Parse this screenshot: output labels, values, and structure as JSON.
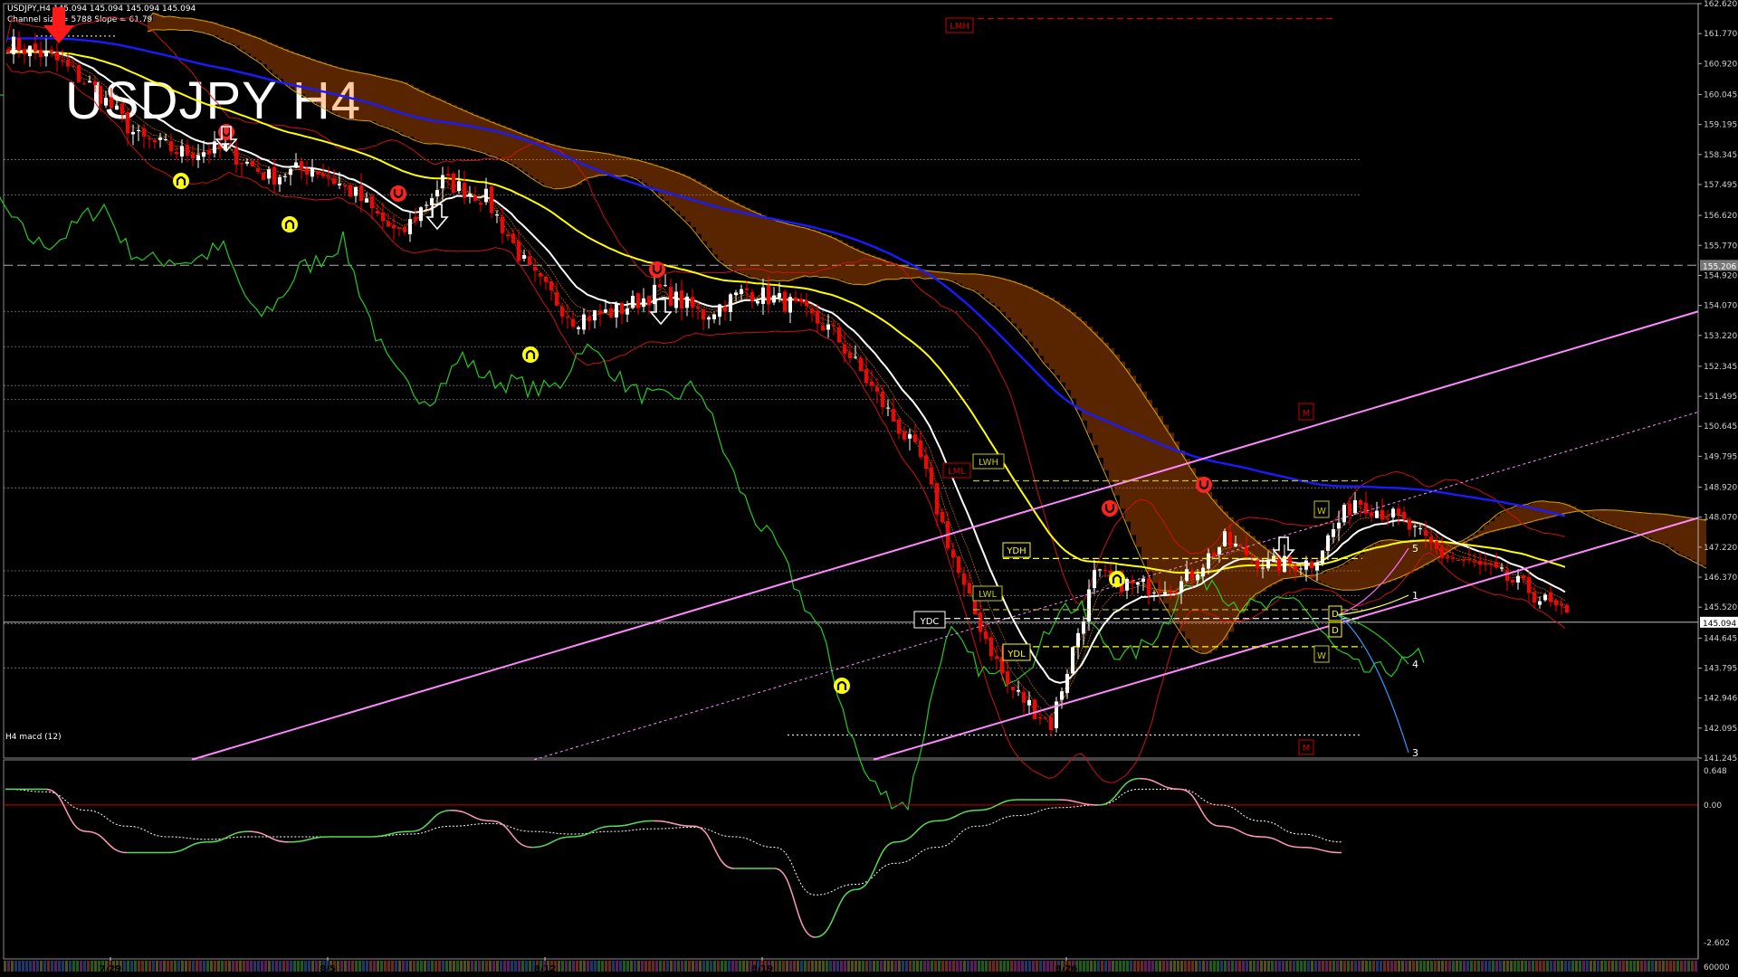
{
  "header": {
    "info_line": "USDJPY,H4  145.094 145.094 145.094 145.094",
    "channel_line": "Channel size = 5788 Slope = 61.79",
    "watermark": "USDJPY H4"
  },
  "sub": {
    "label": "H4  macd (12)"
  },
  "colors": {
    "bg": "#000000",
    "bull": "#ffffff",
    "bear": "#ff0000",
    "ema_white": "#ffffff",
    "ema_yellow": "#ffff00",
    "ema_blue": "#1a1aff",
    "channel": "#ff88ff",
    "chikou": "#22cc22",
    "cloud": "#ff6a00",
    "macd_main": "#55dd55",
    "macd_neg": "#ff99bb",
    "axis": "#d0d0d0"
  },
  "chart_data": [
    {
      "type": "candlestick",
      "symbol": "USDJPY",
      "timeframe": "H4",
      "title": "USDJPY H4",
      "ylim": [
        141.245,
        162.62
      ],
      "yticks": [
        162.62,
        161.77,
        160.92,
        160.045,
        159.195,
        158.345,
        157.495,
        156.62,
        155.77,
        154.92,
        154.07,
        153.22,
        152.345,
        151.495,
        150.645,
        149.795,
        148.92,
        148.07,
        147.22,
        146.37,
        145.52,
        144.645,
        143.795,
        142.946,
        142.095,
        141.245
      ],
      "current_price": 145.094,
      "current_price_label": "145.094",
      "marked_level": 155.206,
      "marked_level_label": "155.206",
      "xticks": [
        "7/29",
        "8/5",
        "8/12",
        "8/19",
        "8/26"
      ],
      "price_path": [
        161.5,
        161.1,
        160.2,
        158.8,
        158.4,
        158.5,
        157.7,
        158.0,
        157.2,
        156.0,
        157.6,
        157.1,
        155.0,
        153.7,
        153.9,
        154.5,
        153.8,
        154.5,
        154.1,
        153.3,
        151.5,
        149.7,
        146.0,
        143.3,
        142.2,
        146.4,
        146.1,
        146.2,
        147.4,
        146.7,
        146.8,
        148.6,
        148.0,
        147.0,
        146.6,
        146.0,
        145.1
      ],
      "price_lines": [
        {
          "label": "LMH",
          "value": 162.2,
          "style": "dashed",
          "color": "#cc0000"
        },
        {
          "label": "LWH",
          "value": 149.1,
          "style": "dashed",
          "color": "#c8c800"
        },
        {
          "label": "YDH",
          "value": 146.9,
          "style": "dashed",
          "color": "#ffff00"
        },
        {
          "label": "LWL",
          "value": 145.45,
          "style": "dashed",
          "color": "#c8c800"
        },
        {
          "label": "YDC",
          "value": 145.2,
          "style": "dashed",
          "color": "#ffffff"
        },
        {
          "label": "YDL",
          "value": 144.4,
          "style": "dashed",
          "color": "#ffff00"
        }
      ],
      "box_labels": [
        {
          "text": "LMH",
          "color": "#cc0000"
        },
        {
          "text": "LWH",
          "color": "#c8c800"
        },
        {
          "text": "LML",
          "color": "#cc0000"
        },
        {
          "text": "YDH",
          "color": "#ffff00"
        },
        {
          "text": "LWL",
          "color": "#c8c800"
        },
        {
          "text": "YDC",
          "color": "#ffffff"
        },
        {
          "text": "YDL",
          "color": "#ffff00"
        },
        {
          "text": "M",
          "color": "#cc0000"
        },
        {
          "text": "M",
          "color": "#cc0000"
        },
        {
          "text": "W",
          "color": "#c8c800"
        },
        {
          "text": "W",
          "color": "#c8c800"
        },
        {
          "text": "D",
          "color": "#ffff00"
        },
        {
          "text": "D",
          "color": "#ffff00"
        }
      ],
      "projection_labels": [
        "5",
        "1",
        "4",
        "3"
      ],
      "series_colors": [
        "#ffffff",
        "#ffff00",
        "#1a1aff",
        "#22cc22",
        "#ff88ff"
      ]
    },
    {
      "type": "line",
      "title": "H4 macd (12)",
      "ylim": [
        -2.602,
        0.648
      ],
      "yticks": [
        0.648,
        0.0,
        -2.602
      ],
      "ytick_labels": [
        "0.648",
        "0.00",
        "-2.602"
      ],
      "bottom_label": "60000",
      "main": [
        0.3,
        0.3,
        -0.5,
        -0.9,
        -0.9,
        -0.7,
        -0.5,
        -0.7,
        -0.6,
        -0.6,
        -0.5,
        -0.1,
        -0.3,
        -0.8,
        -0.6,
        -0.4,
        -0.3,
        -0.4,
        -1.2,
        -1.2,
        -2.5,
        -1.6,
        -0.7,
        -0.3,
        -0.1,
        0.1,
        0.1,
        0.0,
        0.5,
        0.3,
        -0.4,
        -0.6,
        -0.8,
        -0.9
      ],
      "signal": [
        0.3,
        0.25,
        -0.1,
        -0.4,
        -0.6,
        -0.65,
        -0.6,
        -0.6,
        -0.6,
        -0.6,
        -0.55,
        -0.4,
        -0.35,
        -0.5,
        -0.55,
        -0.5,
        -0.45,
        -0.42,
        -0.6,
        -0.8,
        -1.7,
        -1.5,
        -1.1,
        -0.8,
        -0.4,
        -0.2,
        -0.05,
        0.0,
        0.3,
        0.3,
        0.0,
        -0.3,
        -0.55,
        -0.7
      ]
    }
  ]
}
